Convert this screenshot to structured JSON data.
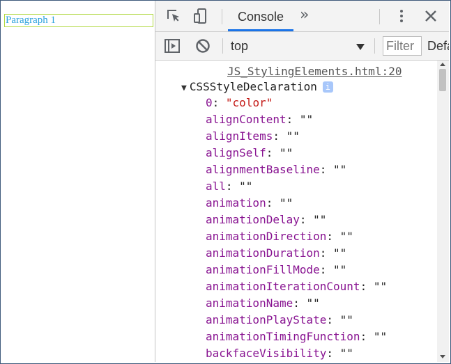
{
  "page": {
    "paragraph": "Paragraph 1"
  },
  "devtools": {
    "tabs": {
      "console_label": "Console",
      "more_tabs": "»"
    },
    "toolbar": {
      "context": "top",
      "filter_placeholder": "Filter",
      "levels_label": "Default levels"
    },
    "console": {
      "source_link": "JS_StylingElements.html:20",
      "object_name": "CSSStyleDeclaration",
      "info_badge": "i",
      "properties": [
        {
          "key": "0",
          "value": "\"color\"",
          "is_string": true
        },
        {
          "key": "alignContent",
          "value": "\"\""
        },
        {
          "key": "alignItems",
          "value": "\"\""
        },
        {
          "key": "alignSelf",
          "value": "\"\""
        },
        {
          "key": "alignmentBaseline",
          "value": "\"\""
        },
        {
          "key": "all",
          "value": "\"\""
        },
        {
          "key": "animation",
          "value": "\"\""
        },
        {
          "key": "animationDelay",
          "value": "\"\""
        },
        {
          "key": "animationDirection",
          "value": "\"\""
        },
        {
          "key": "animationDuration",
          "value": "\"\""
        },
        {
          "key": "animationFillMode",
          "value": "\"\""
        },
        {
          "key": "animationIterationCount",
          "value": "\"\""
        },
        {
          "key": "animationName",
          "value": "\"\""
        },
        {
          "key": "animationPlayState",
          "value": "\"\""
        },
        {
          "key": "animationTimingFunction",
          "value": "\"\""
        },
        {
          "key": "backfaceVisibility",
          "value": "\"\""
        }
      ]
    },
    "colors": {
      "accent": "#1a73e8",
      "property_key": "#881391",
      "string_value": "#c41a16",
      "paragraph_text": "#2aa1dc"
    },
    "icons": [
      "inspect-element-icon",
      "device-toolbar-icon",
      "more-tabs-icon",
      "kebab-menu-icon",
      "close-icon",
      "sidebar-toggle-icon",
      "clear-console-icon",
      "dropdown-arrow-icon"
    ]
  }
}
